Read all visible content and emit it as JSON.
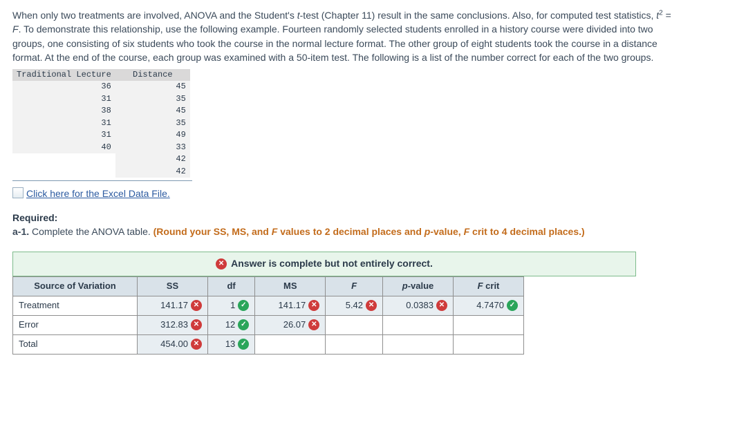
{
  "problem": {
    "pre1": "When only two treatments are involved, ANOVA and the Student's ",
    "t": "t",
    "post1": "-test (Chapter 11) result in the same conclusions. Also, for computed test statistics, ",
    "t2_pre": "t",
    "t2_sup": "2",
    "eq": " = ",
    "F": "F",
    "post2": ". To demonstrate this relationship, use the following example. Fourteen randomly selected students enrolled in a history course were divided into two groups, one consisting of six students who took the course in the normal lecture format. The other group of eight students took the course in a distance format. At the end of the course, each group was examined with a 50-item test. The following is a list of the number correct for each of the two groups."
  },
  "data_table": {
    "headers": [
      "Traditional Lecture",
      "Distance"
    ],
    "rows": [
      [
        "36",
        "45"
      ],
      [
        "31",
        "35"
      ],
      [
        "38",
        "45"
      ],
      [
        "31",
        "35"
      ],
      [
        "31",
        "49"
      ],
      [
        "40",
        "33"
      ],
      [
        "",
        "42"
      ],
      [
        "",
        "42"
      ]
    ]
  },
  "file_link": "Click here for the Excel Data File.",
  "required_label": "Required:",
  "part_label": "a-1.",
  "part_text": " Complete the ANOVA table. ",
  "round_pre": "(Round your SS, MS, and ",
  "round_F": "F",
  "round_mid": " values to 2 decimal places and ",
  "round_p": "p",
  "round_mid2": "-value, ",
  "round_F2": "F",
  "round_post": " crit to 4 decimal places.)",
  "feedback": "Answer is complete but not entirely correct.",
  "anova": {
    "headers": [
      "Source of Variation",
      "SS",
      "df",
      "MS",
      "F",
      "p-value",
      "F crit"
    ],
    "hF": "F",
    "hP_pre": "p",
    "hP_post": "-value",
    "hFcrit_pre": "F",
    "hFcrit_post": " crit",
    "rows": [
      {
        "label": "Treatment",
        "ss": {
          "v": "141.17",
          "m": "x"
        },
        "df": {
          "v": "1",
          "m": "ok"
        },
        "ms": {
          "v": "141.17",
          "m": "x"
        },
        "f": {
          "v": "5.42",
          "m": "x"
        },
        "p": {
          "v": "0.0383",
          "m": "x"
        },
        "fc": {
          "v": "4.7470",
          "m": "ok"
        }
      },
      {
        "label": "Error",
        "ss": {
          "v": "312.83",
          "m": "x"
        },
        "df": {
          "v": "12",
          "m": "ok"
        },
        "ms": {
          "v": "26.07",
          "m": "x"
        }
      },
      {
        "label": "Total",
        "ss": {
          "v": "454.00",
          "m": "x"
        },
        "df": {
          "v": "13",
          "m": "ok"
        }
      }
    ]
  }
}
